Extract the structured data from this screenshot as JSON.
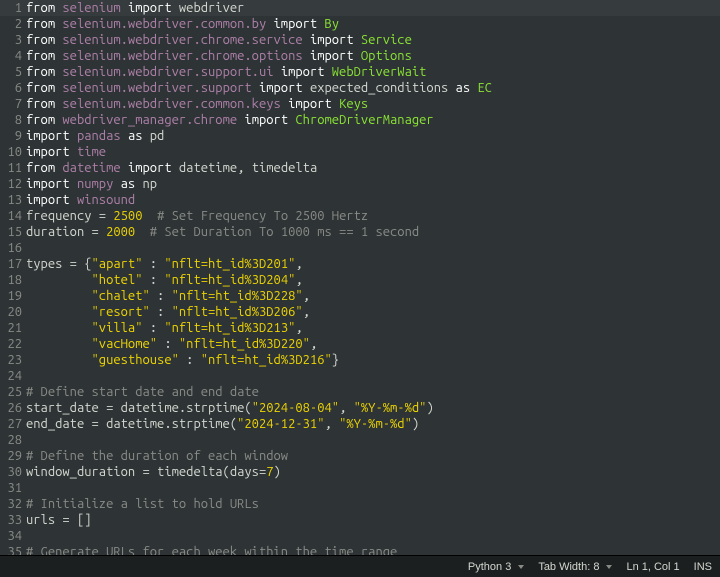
{
  "editor": {
    "highlighted_line": 1,
    "lines": [
      {
        "n": 1,
        "tokens": [
          [
            "kw",
            "from"
          ],
          [
            "id",
            " "
          ],
          [
            "ns",
            "selenium"
          ],
          [
            "id",
            " "
          ],
          [
            "kw",
            "import"
          ],
          [
            "id",
            " "
          ],
          [
            "def",
            "webdriver"
          ]
        ]
      },
      {
        "n": 2,
        "tokens": [
          [
            "kw",
            "from"
          ],
          [
            "id",
            " "
          ],
          [
            "ns",
            "selenium.webdriver.common.by"
          ],
          [
            "id",
            " "
          ],
          [
            "kw",
            "import"
          ],
          [
            "id",
            " "
          ],
          [
            "cls",
            "By"
          ]
        ]
      },
      {
        "n": 3,
        "tokens": [
          [
            "kw",
            "from"
          ],
          [
            "id",
            " "
          ],
          [
            "ns",
            "selenium.webdriver.chrome.service"
          ],
          [
            "id",
            " "
          ],
          [
            "kw",
            "import"
          ],
          [
            "id",
            " "
          ],
          [
            "cls",
            "Service"
          ]
        ]
      },
      {
        "n": 4,
        "tokens": [
          [
            "kw",
            "from"
          ],
          [
            "id",
            " "
          ],
          [
            "ns",
            "selenium.webdriver.chrome.options"
          ],
          [
            "id",
            " "
          ],
          [
            "kw",
            "import"
          ],
          [
            "id",
            " "
          ],
          [
            "cls",
            "Options"
          ]
        ]
      },
      {
        "n": 5,
        "tokens": [
          [
            "kw",
            "from"
          ],
          [
            "id",
            " "
          ],
          [
            "ns",
            "selenium.webdriver.support.ui"
          ],
          [
            "id",
            " "
          ],
          [
            "kw",
            "import"
          ],
          [
            "id",
            " "
          ],
          [
            "cls",
            "WebDriverWait"
          ]
        ]
      },
      {
        "n": 6,
        "tokens": [
          [
            "kw",
            "from"
          ],
          [
            "id",
            " "
          ],
          [
            "ns",
            "selenium.webdriver.support"
          ],
          [
            "id",
            " "
          ],
          [
            "kw",
            "import"
          ],
          [
            "id",
            " "
          ],
          [
            "def",
            "expected_conditions"
          ],
          [
            "id",
            " "
          ],
          [
            "kw",
            "as"
          ],
          [
            "id",
            " "
          ],
          [
            "cls",
            "EC"
          ]
        ]
      },
      {
        "n": 7,
        "tokens": [
          [
            "kw",
            "from"
          ],
          [
            "id",
            " "
          ],
          [
            "ns",
            "selenium.webdriver.common.keys"
          ],
          [
            "id",
            " "
          ],
          [
            "kw",
            "import"
          ],
          [
            "id",
            " "
          ],
          [
            "cls",
            "Keys"
          ]
        ]
      },
      {
        "n": 8,
        "tokens": [
          [
            "kw",
            "from"
          ],
          [
            "id",
            " "
          ],
          [
            "ns",
            "webdriver_manager.chrome"
          ],
          [
            "id",
            " "
          ],
          [
            "kw",
            "import"
          ],
          [
            "id",
            " "
          ],
          [
            "cls",
            "ChromeDriverManager"
          ]
        ]
      },
      {
        "n": 9,
        "tokens": [
          [
            "kw",
            "import"
          ],
          [
            "id",
            " "
          ],
          [
            "ns",
            "pandas"
          ],
          [
            "id",
            " "
          ],
          [
            "kw",
            "as"
          ],
          [
            "id",
            " "
          ],
          [
            "def",
            "pd"
          ]
        ]
      },
      {
        "n": 10,
        "tokens": [
          [
            "kw",
            "import"
          ],
          [
            "id",
            " "
          ],
          [
            "ns",
            "time"
          ]
        ]
      },
      {
        "n": 11,
        "tokens": [
          [
            "kw",
            "from"
          ],
          [
            "id",
            " "
          ],
          [
            "ns",
            "datetime"
          ],
          [
            "id",
            " "
          ],
          [
            "kw",
            "import"
          ],
          [
            "id",
            " "
          ],
          [
            "def",
            "datetime"
          ],
          [
            "id",
            ", "
          ],
          [
            "def",
            "timedelta"
          ]
        ]
      },
      {
        "n": 12,
        "tokens": [
          [
            "kw",
            "import"
          ],
          [
            "id",
            " "
          ],
          [
            "ns",
            "numpy"
          ],
          [
            "id",
            " "
          ],
          [
            "kw",
            "as"
          ],
          [
            "id",
            " "
          ],
          [
            "def",
            "np"
          ]
        ]
      },
      {
        "n": 13,
        "tokens": [
          [
            "kw",
            "import"
          ],
          [
            "id",
            " "
          ],
          [
            "ns",
            "winsound"
          ]
        ]
      },
      {
        "n": 14,
        "tokens": [
          [
            "id",
            "frequency = "
          ],
          [
            "num",
            "2500"
          ],
          [
            "id",
            "  "
          ],
          [
            "cmt",
            "# Set Frequency To 2500 Hertz"
          ]
        ]
      },
      {
        "n": 15,
        "tokens": [
          [
            "id",
            "duration = "
          ],
          [
            "num",
            "2000"
          ],
          [
            "id",
            "  "
          ],
          [
            "cmt",
            "# Set Duration To 1000 ms == 1 second"
          ]
        ]
      },
      {
        "n": 16,
        "tokens": [
          [
            "id",
            ""
          ]
        ]
      },
      {
        "n": 17,
        "tokens": [
          [
            "id",
            "types = {"
          ],
          [
            "str",
            "\"apart\""
          ],
          [
            "id",
            " : "
          ],
          [
            "str",
            "\"nflt=ht_id%3D201\""
          ],
          [
            "id",
            ","
          ]
        ]
      },
      {
        "n": 18,
        "tokens": [
          [
            "id",
            "         "
          ],
          [
            "str",
            "\"hotel\""
          ],
          [
            "id",
            " : "
          ],
          [
            "str",
            "\"nflt=ht_id%3D204\""
          ],
          [
            "id",
            ","
          ]
        ]
      },
      {
        "n": 19,
        "tokens": [
          [
            "id",
            "         "
          ],
          [
            "str",
            "\"chalet\""
          ],
          [
            "id",
            " : "
          ],
          [
            "str",
            "\"nflt=ht_id%3D228\""
          ],
          [
            "id",
            ","
          ]
        ]
      },
      {
        "n": 20,
        "tokens": [
          [
            "id",
            "         "
          ],
          [
            "str",
            "\"resort\""
          ],
          [
            "id",
            " : "
          ],
          [
            "str",
            "\"nflt=ht_id%3D206\""
          ],
          [
            "id",
            ","
          ]
        ]
      },
      {
        "n": 21,
        "tokens": [
          [
            "id",
            "         "
          ],
          [
            "str",
            "\"villa\""
          ],
          [
            "id",
            " : "
          ],
          [
            "str",
            "\"nflt=ht_id%3D213\""
          ],
          [
            "id",
            ","
          ]
        ]
      },
      {
        "n": 22,
        "tokens": [
          [
            "id",
            "         "
          ],
          [
            "str",
            "\"vacHome\""
          ],
          [
            "id",
            " : "
          ],
          [
            "str",
            "\"nflt=ht_id%3D220\""
          ],
          [
            "id",
            ","
          ]
        ]
      },
      {
        "n": 23,
        "tokens": [
          [
            "id",
            "         "
          ],
          [
            "str",
            "\"guesthouse\""
          ],
          [
            "id",
            " : "
          ],
          [
            "str",
            "\"nflt=ht_id%3D216\""
          ],
          [
            "id",
            "}"
          ]
        ]
      },
      {
        "n": 24,
        "tokens": [
          [
            "id",
            ""
          ]
        ]
      },
      {
        "n": 25,
        "tokens": [
          [
            "cmt",
            "# Define start date and end date"
          ]
        ]
      },
      {
        "n": 26,
        "tokens": [
          [
            "id",
            "start_date = datetime.strptime("
          ],
          [
            "str",
            "\"2024-08-04\""
          ],
          [
            "id",
            ", "
          ],
          [
            "str",
            "\"%Y-%m-%d\""
          ],
          [
            "id",
            ")"
          ]
        ]
      },
      {
        "n": 27,
        "tokens": [
          [
            "id",
            "end_date = datetime.strptime("
          ],
          [
            "str",
            "\"2024-12-31\""
          ],
          [
            "id",
            ", "
          ],
          [
            "str",
            "\"%Y-%m-%d\""
          ],
          [
            "id",
            ")"
          ]
        ]
      },
      {
        "n": 28,
        "tokens": [
          [
            "id",
            ""
          ]
        ]
      },
      {
        "n": 29,
        "tokens": [
          [
            "cmt",
            "# Define the duration of each window"
          ]
        ]
      },
      {
        "n": 30,
        "tokens": [
          [
            "id",
            "window_duration = timedelta(days="
          ],
          [
            "num",
            "7"
          ],
          [
            "id",
            ")"
          ]
        ]
      },
      {
        "n": 31,
        "tokens": [
          [
            "id",
            ""
          ]
        ]
      },
      {
        "n": 32,
        "tokens": [
          [
            "cmt",
            "# Initialize a list to hold URLs"
          ]
        ]
      },
      {
        "n": 33,
        "tokens": [
          [
            "id",
            "urls = []"
          ]
        ]
      },
      {
        "n": 34,
        "tokens": [
          [
            "id",
            ""
          ]
        ]
      },
      {
        "n": 35,
        "tokens": [
          [
            "cmt",
            "# Generate URLs for each week within the time range"
          ]
        ]
      }
    ]
  },
  "statusbar": {
    "language": "Python 3",
    "tab_width_label": "Tab Width: 8",
    "position": "Ln 1, Col 1",
    "mode": "INS"
  }
}
